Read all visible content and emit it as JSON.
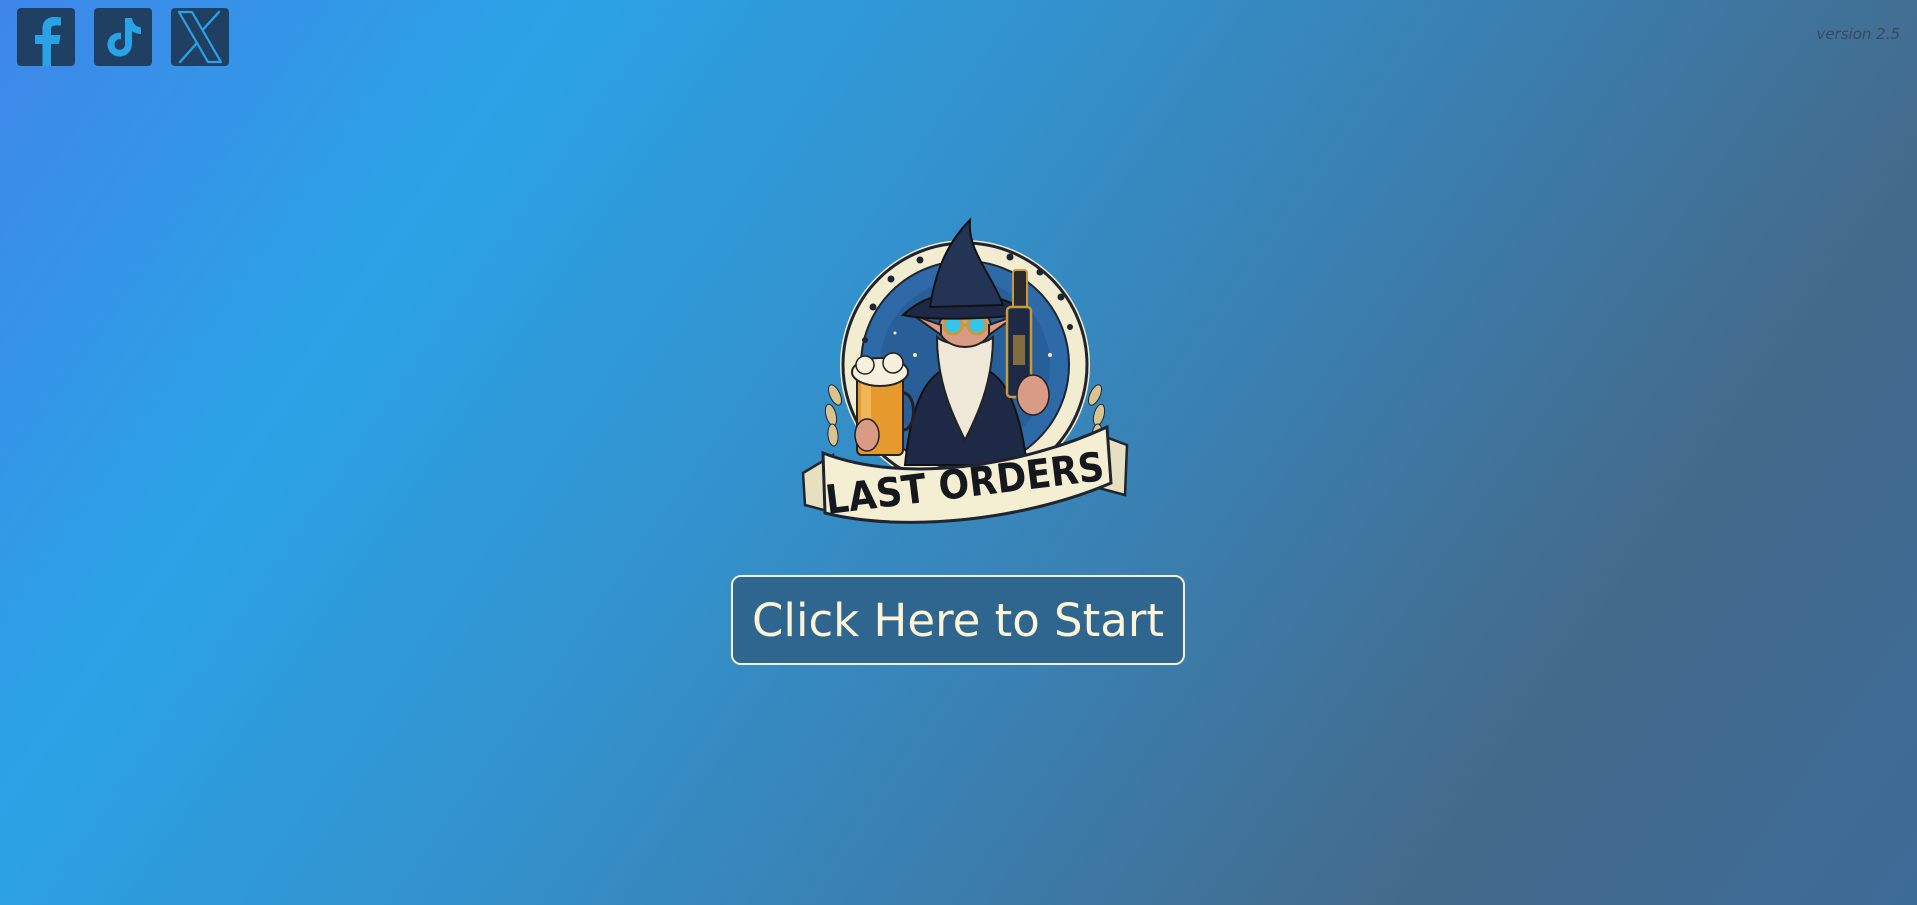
{
  "social": {
    "icons": [
      {
        "name": "facebook-icon"
      },
      {
        "name": "tiktok-icon"
      },
      {
        "name": "x-icon"
      }
    ]
  },
  "version": {
    "text": "version 2.5"
  },
  "logo": {
    "text": "LAST ORDERS",
    "icon": "wizard-logo"
  },
  "start_button": {
    "label": "Click Here to Start"
  },
  "colors": {
    "icon_bg": "#1f3f63",
    "icon_fg": "#2aa2e6",
    "button_bg": "#2f6690",
    "button_border": "#f4efd2",
    "button_text": "#fbf4d6",
    "banner": "#f4efd2",
    "dark_navy": "#1e3557"
  }
}
